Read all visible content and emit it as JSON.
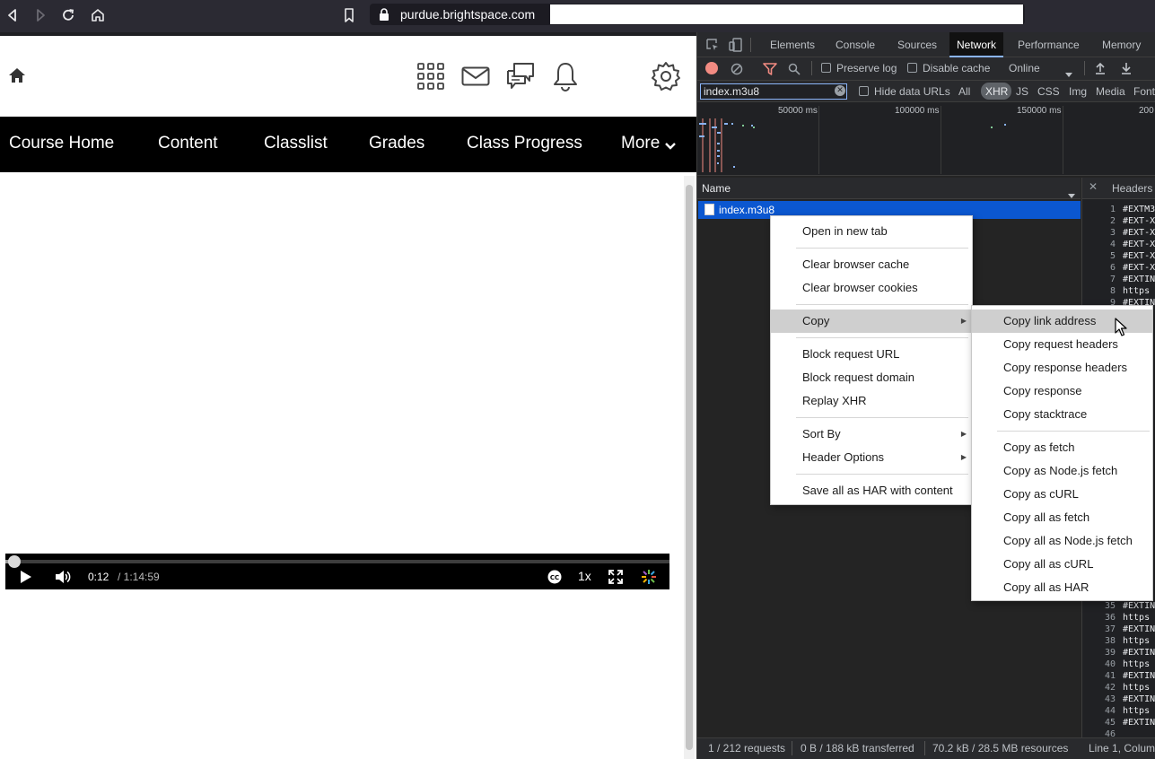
{
  "browser": {
    "url": "purdue.brightspace.com"
  },
  "course_nav": {
    "items": [
      "Course Home",
      "Content",
      "Classlist",
      "Grades",
      "Class Progress",
      "More"
    ]
  },
  "player": {
    "current_time": "0:12",
    "duration": "/ 1:14:59",
    "speed": "1x",
    "progress_fraction": 0.003
  },
  "devtools": {
    "tabs": [
      "Elements",
      "Console",
      "Sources",
      "Network",
      "Performance",
      "Memory"
    ],
    "active_tab": "Network",
    "toolbar": {
      "preserve_log": "Preserve log",
      "disable_cache": "Disable cache",
      "throttle": "Online"
    },
    "filter": {
      "value": "index.m3u8",
      "hide_data_urls": "Hide data URLs",
      "types": [
        "All",
        "XHR",
        "JS",
        "CSS",
        "Img",
        "Media",
        "Font"
      ],
      "active_type": "XHR"
    },
    "overview_ticks": [
      "50000 ms",
      "100000 ms",
      "150000 ms",
      "200"
    ],
    "name_header": "Name",
    "request_name": "index.m3u8",
    "detail_tab": "Headers",
    "code_lines_top": [
      {
        "n": "1",
        "t": "#EXTM3"
      },
      {
        "n": "2",
        "t": "#EXT-X"
      },
      {
        "n": "3",
        "t": "#EXT-X"
      },
      {
        "n": "4",
        "t": "#EXT-X"
      },
      {
        "n": "5",
        "t": "#EXT-X"
      },
      {
        "n": "6",
        "t": "#EXT-X"
      },
      {
        "n": "7",
        "t": "#EXTIN"
      },
      {
        "n": "8",
        "t": "https"
      },
      {
        "n": "9",
        "t": "#EXTIN"
      }
    ],
    "code_lines_bottom": [
      {
        "n": "35",
        "t": "#EXTIN"
      },
      {
        "n": "36",
        "t": "https"
      },
      {
        "n": "37",
        "t": "#EXTIN"
      },
      {
        "n": "38",
        "t": "https"
      },
      {
        "n": "39",
        "t": "#EXTIN"
      },
      {
        "n": "40",
        "t": "https"
      },
      {
        "n": "41",
        "t": "#EXTIN"
      },
      {
        "n": "42",
        "t": "https"
      },
      {
        "n": "43",
        "t": "#EXTIN"
      },
      {
        "n": "44",
        "t": "https"
      },
      {
        "n": "45",
        "t": "#EXTIN"
      },
      {
        "n": "46",
        "t": ""
      }
    ],
    "status": {
      "requests": "1 / 212 requests",
      "transferred": "0 B / 188 kB transferred",
      "resources": "70.2 kB / 28.5 MB resources",
      "cursor": "Line 1, Colum"
    }
  },
  "context_menu": {
    "items": [
      "Open in new tab",
      "Clear browser cache",
      "Clear browser cookies",
      "Copy",
      "Block request URL",
      "Block request domain",
      "Replay XHR",
      "Sort By",
      "Header Options",
      "Save all as HAR with content"
    ]
  },
  "copy_submenu": {
    "items": [
      "Copy link address",
      "Copy request headers",
      "Copy response headers",
      "Copy response",
      "Copy stacktrace",
      "Copy as fetch",
      "Copy as Node.js fetch",
      "Copy as cURL",
      "Copy all as fetch",
      "Copy all as Node.js fetch",
      "Copy all as cURL",
      "Copy all as HAR"
    ]
  },
  "colors": {
    "devtools_bg": "#242424",
    "selection": "#0b57d0",
    "record": "#f28b82",
    "menu_highlight": "#cfcfcf"
  }
}
